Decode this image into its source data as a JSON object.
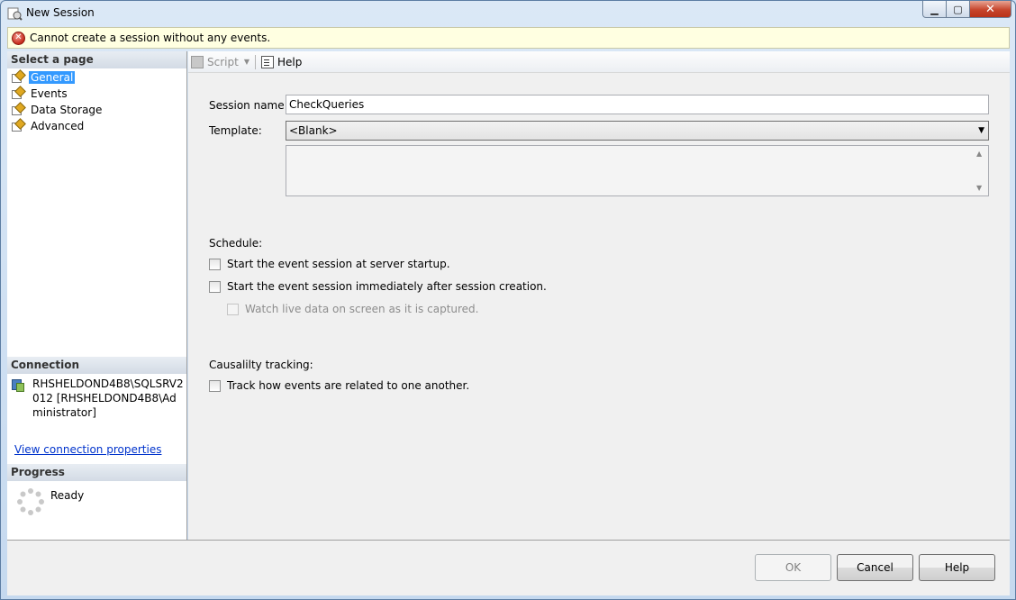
{
  "window": {
    "title": "New Session",
    "controls": {
      "minimize": "▁",
      "maximize": "▢",
      "close": "✕"
    }
  },
  "error": {
    "message": "Cannot create a session without any events.",
    "icon": "error-icon"
  },
  "sidebar": {
    "select_page_header": "Select a page",
    "pages": [
      {
        "label": "General",
        "selected": true
      },
      {
        "label": "Events",
        "selected": false
      },
      {
        "label": "Data Storage",
        "selected": false
      },
      {
        "label": "Advanced",
        "selected": false
      }
    ],
    "connection_header": "Connection",
    "connection_text": "RHSHELDOND4B8\\SQLSRV2012 [RHSHELDOND4B8\\Administrator]",
    "connection_link": "View connection properties",
    "progress_header": "Progress",
    "progress_status": "Ready"
  },
  "toolbar": {
    "script_label": "Script",
    "help_label": "Help"
  },
  "form": {
    "session_name_label": "Session name:",
    "session_name_value": "CheckQueries",
    "template_label": "Template:",
    "template_value": "<Blank>",
    "schedule_label": "Schedule:",
    "start_at_startup_label": "Start the event session at server startup.",
    "start_immediately_label": "Start the event session immediately after session creation.",
    "watch_live_label": "Watch live data on screen as it is captured.",
    "causality_label": "Causalilty tracking:",
    "track_label": "Track how events are related to one another."
  },
  "buttons": {
    "ok": "OK",
    "cancel": "Cancel",
    "help": "Help"
  }
}
